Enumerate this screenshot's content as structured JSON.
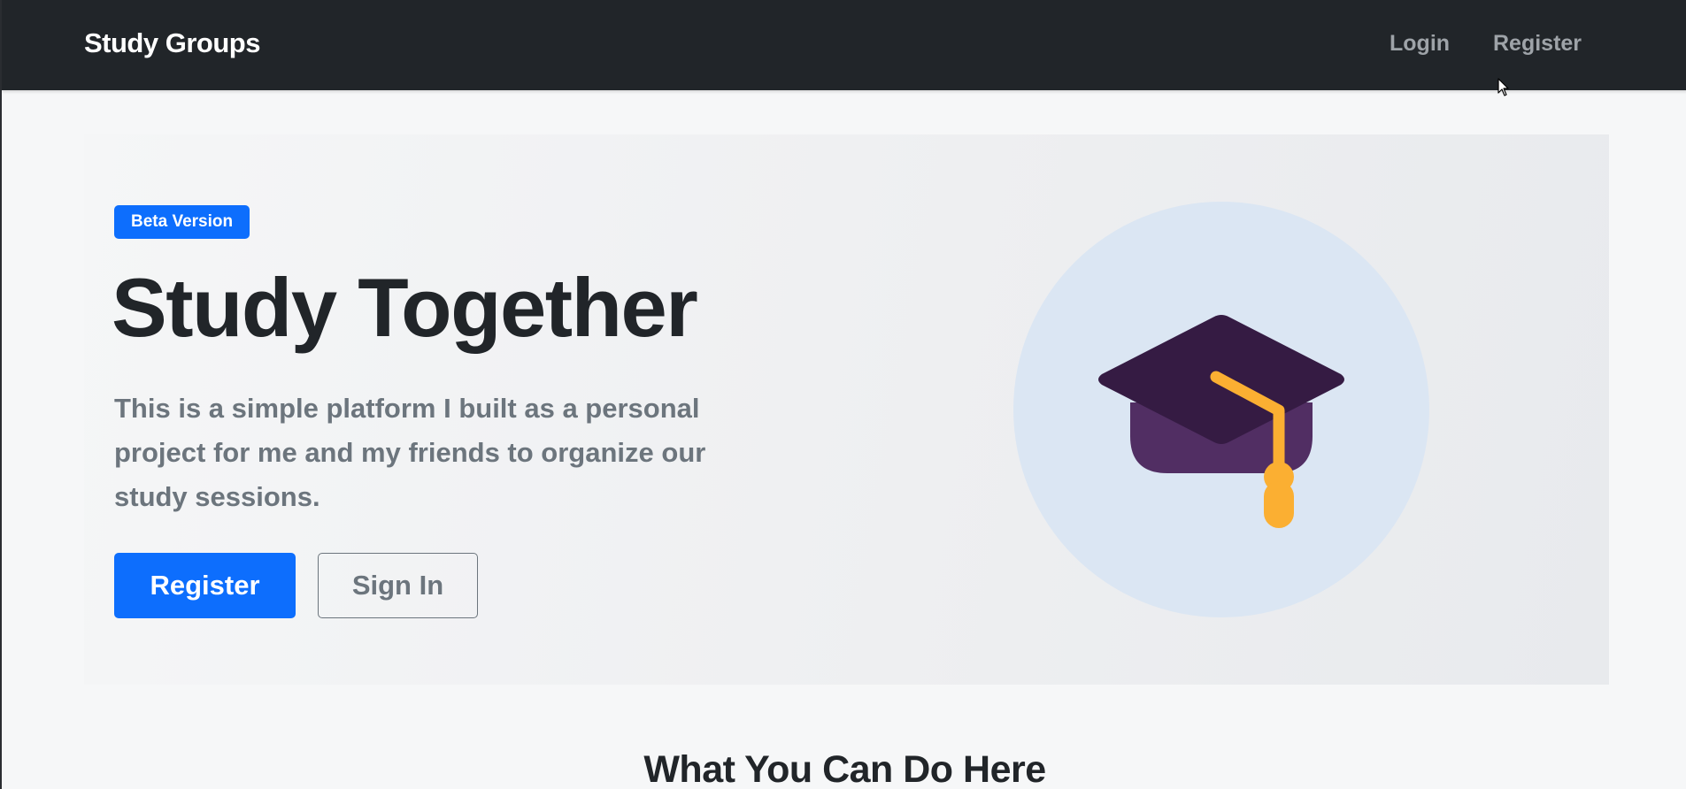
{
  "navbar": {
    "brand": "Study Groups",
    "links": [
      {
        "label": "Login"
      },
      {
        "label": "Register"
      }
    ]
  },
  "hero": {
    "badge": "Beta Version",
    "title": "Study Together",
    "description": "This is a simple platform I built as a personal project for me and my friends to organize our study sessions.",
    "primary_button": "Register",
    "secondary_button": "Sign In",
    "illustration": "graduation-cap-icon"
  },
  "features": {
    "title": "What You Can Do Here"
  },
  "colors": {
    "navbar_bg": "#212529",
    "primary": "#0d6efd",
    "muted_text": "#6c757d",
    "cap_top": "#351b43",
    "cap_base": "#512e63",
    "tassel": "#fbaf32",
    "circle_bg": "#dbe6f3"
  }
}
